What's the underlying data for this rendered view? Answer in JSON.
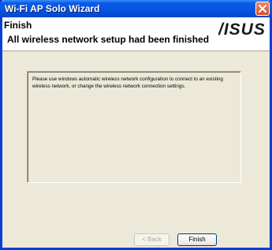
{
  "window": {
    "title": "Wi-Fi AP Solo Wizard"
  },
  "header": {
    "title": "Finish",
    "subtitle": "All wireless network setup had been finished",
    "logo_text": "/ISUS"
  },
  "content": {
    "message": "Please use windows automatic wireless network configuration to connect to an existing wireless network, or change the wireless network connection settings."
  },
  "buttons": {
    "back_label": "< Back",
    "finish_label": "Finish"
  },
  "colors": {
    "titlebar": "#0655e2",
    "dialog_background": "#ece9d8",
    "close_button": "#d5502b"
  },
  "icons": {
    "close": "close-icon",
    "logo": "asus-logo"
  }
}
